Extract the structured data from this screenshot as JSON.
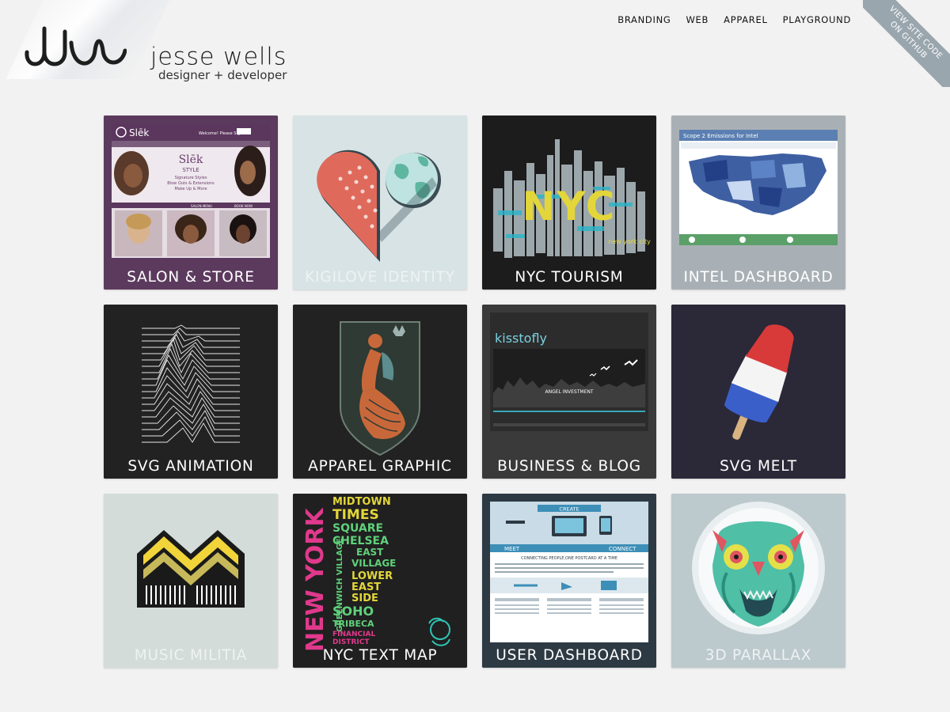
{
  "brand": {
    "name": "jesse wells",
    "tagline": "designer + developer"
  },
  "nav": {
    "items": [
      "BRANDING",
      "WEB",
      "APPAREL",
      "PLAYGROUND"
    ]
  },
  "ribbon": {
    "line1": "VIEW SITE CODE",
    "line2": "ON GITHUB"
  },
  "tiles": [
    {
      "label": "SALON & STORE",
      "bg": "#5c3a5e"
    },
    {
      "label": "KIGILOVE IDENTITY",
      "bg": "#d7e3e5"
    },
    {
      "label": "NYC TOURISM",
      "bg": "#1c1c1c"
    },
    {
      "label": "INTEL DASHBOARD",
      "bg": "#a9b0b5"
    },
    {
      "label": "SVG ANIMATION",
      "bg": "#222222"
    },
    {
      "label": "APPAREL GRAPHIC",
      "bg": "#222222"
    },
    {
      "label": "BUSINESS & BLOG",
      "bg": "#3a3a3a"
    },
    {
      "label": "SVG MELT",
      "bg": "#2b2838"
    },
    {
      "label": "MUSIC MILITIA",
      "bg": "#d3dcd8"
    },
    {
      "label": "NYC TEXT MAP",
      "bg": "#202020"
    },
    {
      "label": "USER DASHBOARD",
      "bg": "#2d3a44"
    },
    {
      "label": "3D PARALLAX",
      "bg": "#bcc9cd"
    }
  ],
  "thumbs": {
    "salon": {
      "logo": "Slēk",
      "welcome": "Welcome! Please Sign In",
      "style_title": "Slēk",
      "style_sub": "STYLE",
      "lines": [
        "Signature Styles",
        "Blow Outs & Extensions",
        "Make Up & More"
      ],
      "menu": "SALON MENU",
      "book": "BOOK NOW"
    },
    "nyc": {
      "word": "NYC",
      "sub": "new york city"
    },
    "intel": {
      "title": "Scope 2 Emissions for Intel"
    },
    "blog": {
      "logo": "kisstofly",
      "banner": "ANGEL INVESTMENT"
    },
    "textmap": {
      "vertical": "NEW YORK",
      "words": [
        "MIDTOWN",
        "TIMES",
        "SQUARE",
        "CHELSEA",
        "EAST",
        "VILLAGE",
        "LOWER",
        "EAST",
        "SIDE",
        "SOHO",
        "TRIBECA",
        "FINANCIAL",
        "DISTRICT"
      ],
      "side": "GREENWICH VILLAGE"
    },
    "dashboard": {
      "create": "CREATE",
      "meet": "MEET",
      "connect": "CONNECT",
      "headline": "CONNECTING PEOPLE,ONE POSTCARD AT A TIME"
    }
  }
}
